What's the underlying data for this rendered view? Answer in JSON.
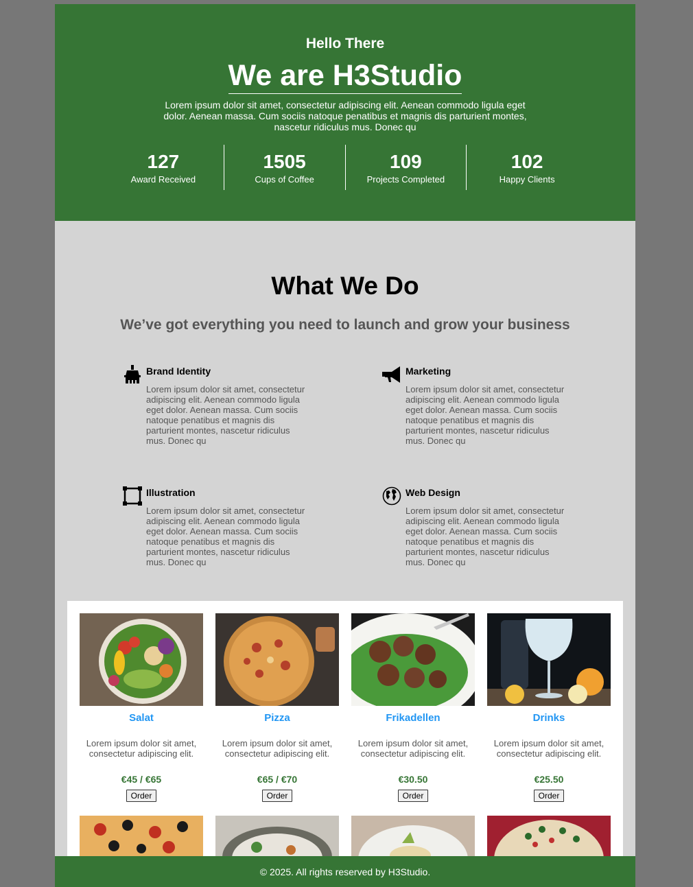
{
  "hero": {
    "greeting": "Hello There",
    "title": "We are H3Studio",
    "description": "Lorem ipsum dolor sit amet, consectetur adipiscing elit. Aenean commodo ligula eget dolor. Aenean massa. Cum sociis natoque penatibus et magnis dis parturient montes, nascetur ridiculus mus. Donec qu",
    "stats": [
      {
        "number": "127",
        "label": "Award Received"
      },
      {
        "number": "1505",
        "label": "Cups of Coffee"
      },
      {
        "number": "109",
        "label": "Projects Completed"
      },
      {
        "number": "102",
        "label": "Happy Clients"
      }
    ]
  },
  "services": {
    "title": "What We Do",
    "subtitle": "We’ve got everything you need to launch and grow your business",
    "items": [
      {
        "icon": "brush-icon",
        "title": "Brand Identity",
        "description": "Lorem ipsum dolor sit amet, consectetur adipiscing elit. Aenean commodo ligula eget dolor. Aenean massa. Cum sociis natoque penatibus et magnis dis parturient montes, nascetur ridiculus mus. Donec qu"
      },
      {
        "icon": "megaphone-icon",
        "title": "Marketing",
        "description": "Lorem ipsum dolor sit amet, consectetur adipiscing elit. Aenean commodo ligula eget dolor. Aenean massa. Cum sociis natoque penatibus et magnis dis parturient montes, nascetur ridiculus mus. Donec qu"
      },
      {
        "icon": "vector-square-icon",
        "title": "Illustration",
        "description": "Lorem ipsum dolor sit amet, consectetur adipiscing elit. Aenean commodo ligula eget dolor. Aenean massa. Cum sociis natoque penatibus et magnis dis parturient montes, nascetur ridiculus mus. Donec qu"
      },
      {
        "icon": "globe-icon",
        "title": "Web Design",
        "description": "Lorem ipsum dolor sit amet, consectetur adipiscing elit. Aenean commodo ligula eget dolor. Aenean massa. Cum sociis natoque penatibus et magnis dis parturient montes, nascetur ridiculus mus. Donec qu"
      }
    ]
  },
  "menu": {
    "items": [
      {
        "name": "Salat",
        "description": "Lorem ipsum dolor sit amet, consectetur adipiscing elit.",
        "price": "€45 / €65",
        "order_label": "Order",
        "image": "salad-bowl-photo"
      },
      {
        "name": "Pizza",
        "description": "Lorem ipsum dolor sit amet, consectetur adipiscing elit.",
        "price": "€65 / €70",
        "order_label": "Order",
        "image": "pizza-photo"
      },
      {
        "name": "Frikadellen",
        "description": "Lorem ipsum dolor sit amet, consectetur adipiscing elit.",
        "price": "€30.50",
        "order_label": "Order",
        "image": "meatballs-photo"
      },
      {
        "name": "Drinks",
        "description": "Lorem ipsum dolor sit amet, consectetur adipiscing elit.",
        "price": "€25.50",
        "order_label": "Order",
        "image": "gin-tonic-photo"
      }
    ],
    "second_row_images": [
      "pepperoni-pizza-photo",
      "rice-bowl-photo",
      "pasta-photo",
      "festive-pizza-photo"
    ]
  },
  "footer": {
    "text": "© 2025. All rights reserved by H3Studio."
  },
  "colors": {
    "brand_green": "#367535",
    "link_blue": "#2196f3",
    "section_gray": "#d4d4d4"
  }
}
